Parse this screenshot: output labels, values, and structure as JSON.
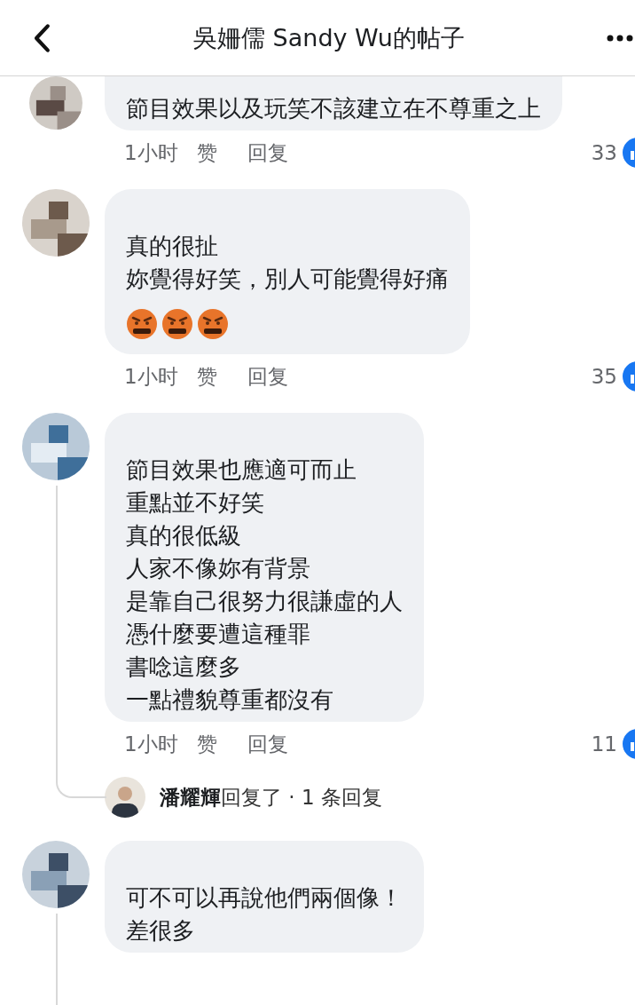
{
  "header": {
    "title": "吳姍儒 Sandy Wu的帖子"
  },
  "comments": [
    {
      "lines": [
        "節目效果以及玩笑不該建立在不尊重之上"
      ],
      "meta": {
        "time": "1小时",
        "like": "赞",
        "reply": "回复",
        "reactions": "33"
      }
    },
    {
      "lines": [
        "真的很扯",
        "妳覺得好笑，別人可能覺得好痛"
      ],
      "emojis": [
        {
          "kind": "angry"
        },
        {
          "kind": "angry"
        },
        {
          "kind": "angry"
        }
      ],
      "meta": {
        "time": "1小时",
        "like": "赞",
        "reply": "回复",
        "reactions": "35"
      }
    },
    {
      "lines": [
        "節目效果也應適可而止",
        "重點並不好笑",
        "真的很低級",
        "人家不像妳有背景",
        "是靠自己很努力很謙虛的人",
        "憑什麼要遭這種罪",
        "書唸這麼多",
        "一點禮貌尊重都沒有"
      ],
      "meta": {
        "time": "1小时",
        "like": "赞",
        "reply": "回复",
        "reactions": "11"
      },
      "replies": {
        "name": "潘耀輝",
        "text": "回复了 · 1 条回复"
      }
    },
    {
      "lines": [
        "可不可以再說他們兩個像！",
        "差很多"
      ]
    }
  ]
}
